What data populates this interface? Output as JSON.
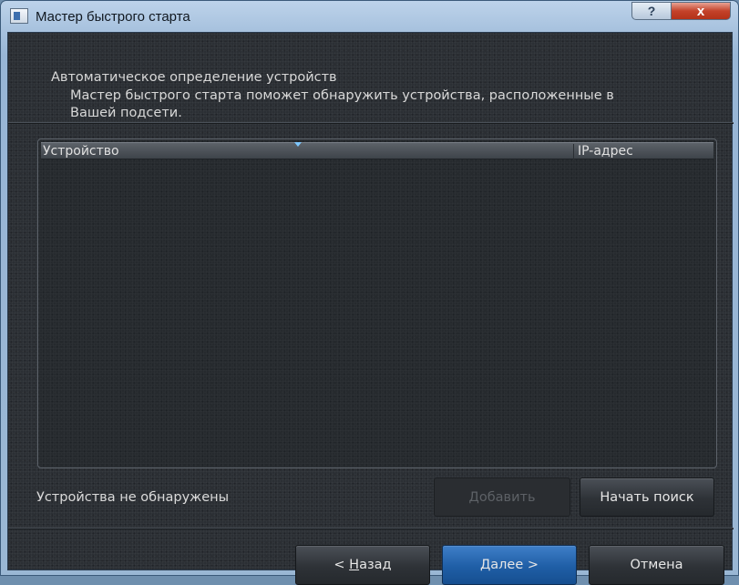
{
  "window": {
    "title": "Мастер быстрого старта",
    "help_label": "?",
    "close_label": "x"
  },
  "header": {
    "heading": "Автоматическое определение устройств",
    "description": "Мастер быстрого старта поможет обнаружить устройства, расположенные в Вашей подсети."
  },
  "table": {
    "columns": [
      "Устройство",
      "IP-адрес"
    ],
    "sort_column": "Устройство",
    "rows": []
  },
  "status_text": "Устройства не обнаружены",
  "buttons": {
    "add": "Добавить",
    "start_search": "Начать поиск",
    "back_prefix": "< ",
    "back_mnemonic": "Н",
    "back_rest": "азад",
    "next_mnemonic": "Д",
    "next_rest": "алее >",
    "cancel": "Отмена"
  },
  "colors": {
    "accent_button": "#1f5ea6",
    "close_button": "#c4422a",
    "background": "#2b2f34"
  },
  "icons": [
    "app-icon",
    "help-icon",
    "close-icon",
    "sort-arrow-icon"
  ]
}
